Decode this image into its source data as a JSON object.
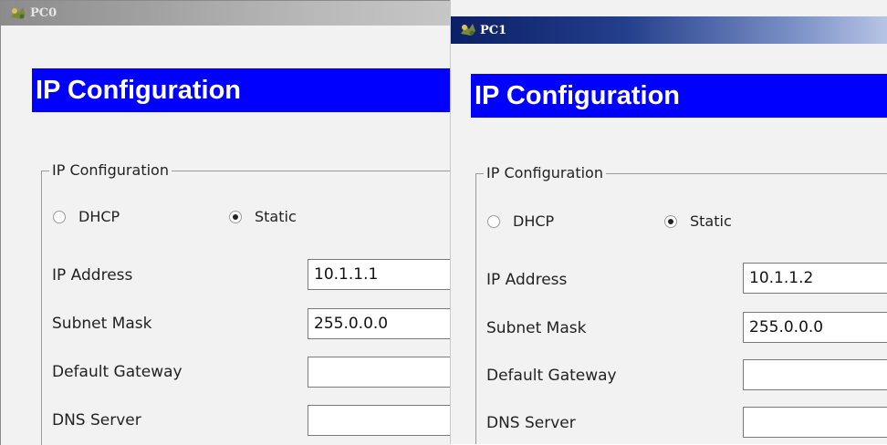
{
  "pc0": {
    "title": "PC0",
    "banner": "IP Configuration",
    "group_legend": "IP Configuration",
    "dhcp_label": "DHCP",
    "static_label": "Static",
    "selected_mode": "Static",
    "fields": {
      "ip_label": "IP Address",
      "ip_value": "10.1.1.1",
      "mask_label": "Subnet Mask",
      "mask_value": "255.0.0.0",
      "gateway_label": "Default Gateway",
      "gateway_value": "",
      "dns_label": "DNS Server",
      "dns_value": ""
    }
  },
  "pc1": {
    "title": "PC1",
    "banner": "IP Configuration",
    "group_legend": "IP Configuration",
    "dhcp_label": "DHCP",
    "static_label": "Static",
    "selected_mode": "Static",
    "fields": {
      "ip_label": "IP Address",
      "ip_value": "10.1.1.2",
      "mask_label": "Subnet Mask",
      "mask_value": "255.0.0.0",
      "gateway_label": "Default Gateway",
      "gateway_value": "",
      "dns_label": "DNS Server",
      "dns_value": ""
    }
  },
  "icons": {
    "window_icon": "packet-tracer-pc-icon"
  },
  "colors": {
    "banner_bg": "#0000ff",
    "active_title": "#0b1f66",
    "inactive_title": "#8c8c8c"
  }
}
